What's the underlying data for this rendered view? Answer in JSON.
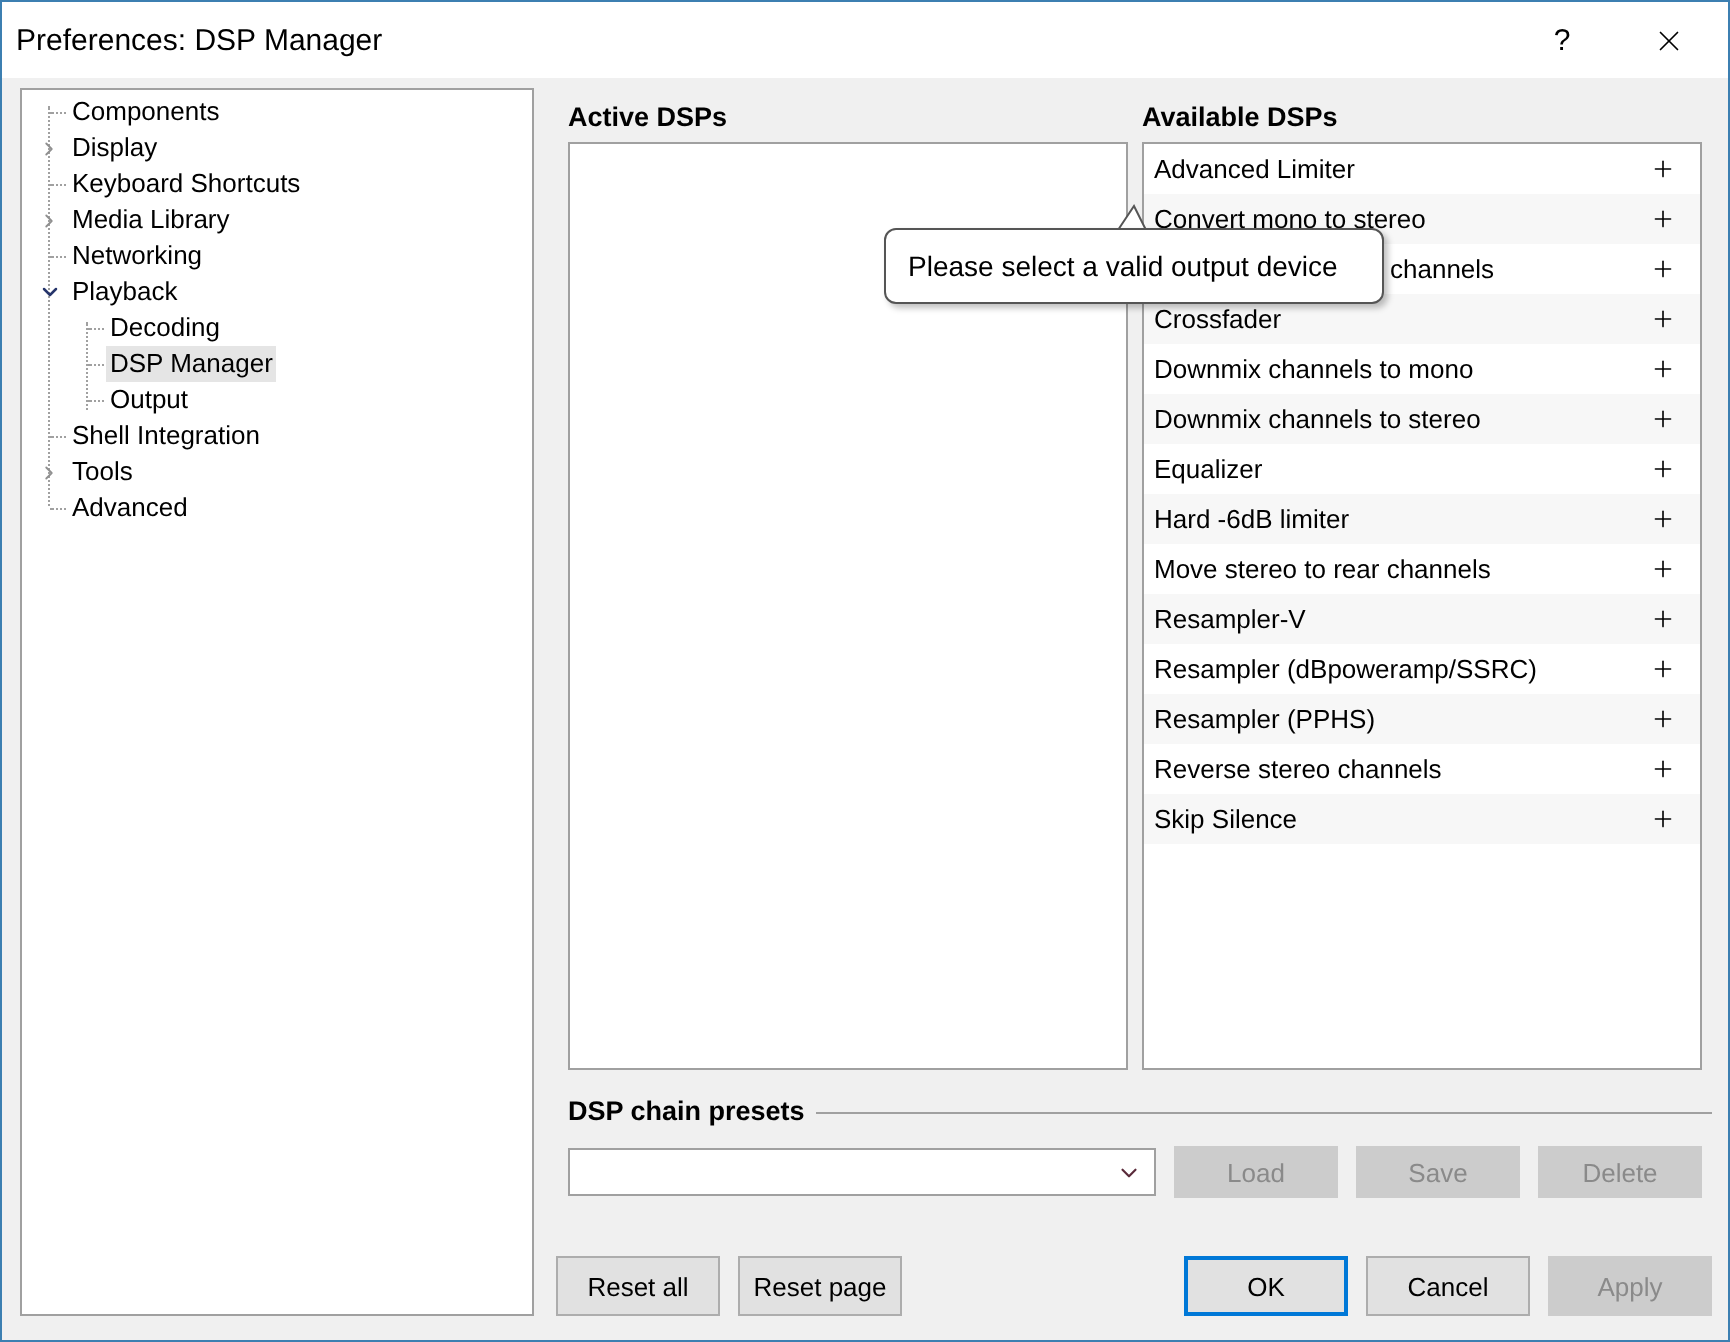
{
  "window": {
    "title": "Preferences: DSP Manager",
    "help": "?"
  },
  "tree": [
    {
      "label": "Components",
      "selected": false
    },
    {
      "label": "Display",
      "selected": false,
      "expanded": false
    },
    {
      "label": "Keyboard Shortcuts",
      "selected": false
    },
    {
      "label": "Media Library",
      "selected": false,
      "expanded": false
    },
    {
      "label": "Networking",
      "selected": false
    },
    {
      "label": "Playback",
      "selected": false,
      "expanded": true,
      "children": [
        {
          "label": "Decoding",
          "selected": false
        },
        {
          "label": "DSP Manager",
          "selected": true
        },
        {
          "label": "Output",
          "selected": false
        }
      ]
    },
    {
      "label": "Shell Integration",
      "selected": false
    },
    {
      "label": "Tools",
      "selected": false,
      "expanded": false
    },
    {
      "label": "Advanced",
      "selected": false
    }
  ],
  "active_dsps": {
    "heading": "Active DSPs"
  },
  "available_dsps": {
    "heading": "Available DSPs",
    "items": [
      {
        "name": "Advanced Limiter",
        "kind": "full"
      },
      {
        "name": "Convert mono to stereo",
        "kind": "full"
      },
      {
        "name": "channels",
        "kind": "clipped"
      },
      {
        "name": "Crossfader",
        "kind": "full"
      },
      {
        "name": "Downmix channels to mono",
        "kind": "full"
      },
      {
        "name": "Downmix channels to stereo",
        "kind": "full"
      },
      {
        "name": "Equalizer",
        "kind": "full"
      },
      {
        "name": "Hard -6dB limiter",
        "kind": "full"
      },
      {
        "name": "Move stereo to rear channels",
        "kind": "full"
      },
      {
        "name": "Resampler-V",
        "kind": "full"
      },
      {
        "name": "Resampler (dBpoweramp/SSRC)",
        "kind": "full"
      },
      {
        "name": "Resampler (PPHS)",
        "kind": "full"
      },
      {
        "name": "Reverse stereo channels",
        "kind": "full"
      },
      {
        "name": "Skip Silence",
        "kind": "full"
      }
    ]
  },
  "tooltip": "Please select a valid output device",
  "presets": {
    "heading": "DSP chain presets",
    "buttons": [
      {
        "label": "Load",
        "disabled": true
      },
      {
        "label": "Save",
        "disabled": true
      },
      {
        "label": "Delete",
        "disabled": true
      }
    ]
  },
  "left_buttons": [
    {
      "label": "Reset all",
      "disabled": false,
      "default": false
    },
    {
      "label": "Reset page",
      "disabled": false,
      "default": false
    }
  ],
  "right_buttons": [
    {
      "label": "OK",
      "disabled": false,
      "default": true
    },
    {
      "label": "Cancel",
      "disabled": false,
      "default": false
    },
    {
      "label": "Apply",
      "disabled": true,
      "default": false
    }
  ]
}
